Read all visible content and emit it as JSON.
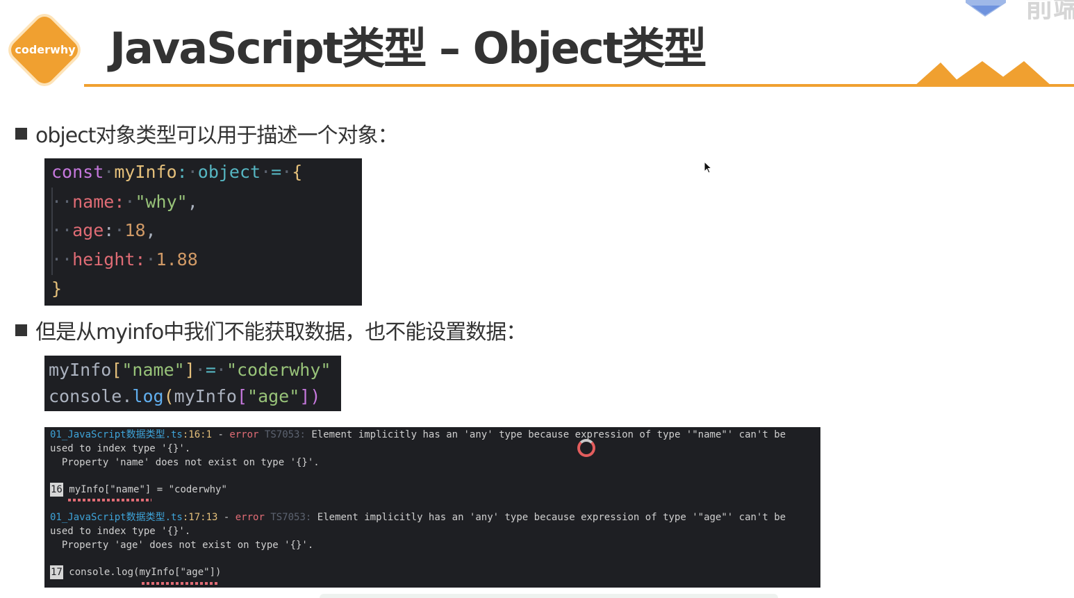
{
  "header": {
    "logo_text": "coderwhy",
    "title": "JavaScript类型 – Object类型",
    "corner_text": "前端",
    "accent_color": "#f0a030"
  },
  "bullets": [
    {
      "text": "object对象类型可以用于描述一个对象："
    },
    {
      "text": "但是从myinfo中我们不能获取数据，也不能设置数据："
    }
  ],
  "code_block_1": {
    "lines": [
      [
        "const",
        "myInfo",
        ":",
        "object",
        "=",
        "{"
      ],
      [
        "name",
        ":",
        "\"why\"",
        ","
      ],
      [
        "age",
        ":",
        "18",
        ","
      ],
      [
        "height",
        ":",
        "1.88"
      ],
      [
        "}"
      ]
    ]
  },
  "code_block_2": {
    "line1": [
      "myInfo",
      "[",
      "\"name\"",
      "]",
      "=",
      "\"coderwhy\""
    ],
    "line2": [
      "console",
      ".",
      "log",
      "(",
      "myInfo",
      "[",
      "\"age\"",
      "])"
    ]
  },
  "terminal": {
    "errors": [
      {
        "file": "01_JavaScript数据类型.ts",
        "position": ":16:1",
        "separator": " - ",
        "level": "error",
        "code": "TS7053:",
        "message": "Element implicitly has an 'any' type because expression of type '\"name\"' can't be",
        "message_cont": "used to index type '{}'.",
        "detail": "  Property 'name' does not exist on type '{}'.",
        "line_number": "16",
        "source": "myInfo[\"name\"] = \"coderwhy\""
      },
      {
        "file": "01_JavaScript数据类型.ts",
        "position": ":17:13",
        "separator": " - ",
        "level": "error",
        "code": "TS7053:",
        "message": "Element implicitly has an 'any' type because expression of type '\"age\"' can't be",
        "message_cont": "used to index type '{}'.",
        "detail": "  Property 'age' does not exist on type '{}'.",
        "line_number": "17",
        "source": "console.log(myInfo[\"age\"])"
      }
    ]
  }
}
